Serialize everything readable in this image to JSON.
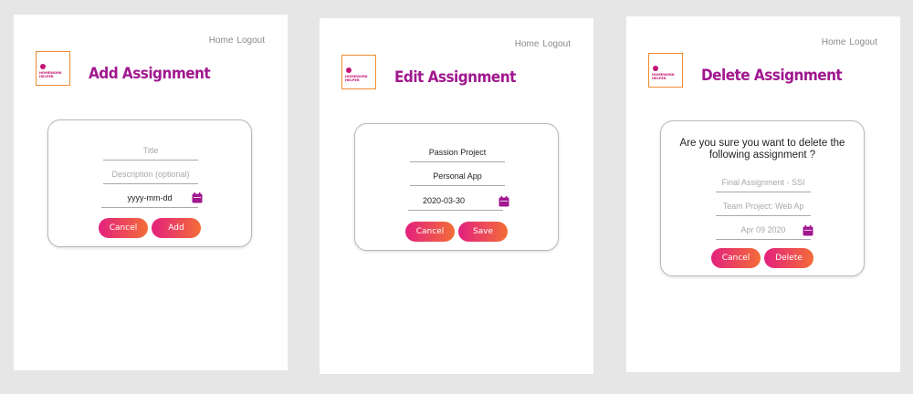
{
  "screens": {
    "add": {
      "nav": {
        "home": "Home",
        "logout": "Logout"
      },
      "logo_text": "HOMEWORK\nHELPER",
      "title": "Add Assignment",
      "fields": {
        "title_placeholder": "Title",
        "description_placeholder": "Description (optional)",
        "date_placeholder": "yyyy-mm-dd"
      },
      "buttons": {
        "cancel": "Cancel",
        "submit": "Add"
      }
    },
    "edit": {
      "nav": {
        "home": "Home",
        "logout": "Logout"
      },
      "logo_text": "HOMEWORK\nHELPER",
      "title": "Edit Assignment",
      "fields": {
        "title_value": "Passion Project",
        "description_value": "Personal App",
        "date_value": "2020-03-30"
      },
      "buttons": {
        "cancel": "Cancel",
        "submit": "Save"
      }
    },
    "delete": {
      "nav": {
        "home": "Home",
        "logout": "Logout"
      },
      "logo_text": "HOMEWORK\nHELPER",
      "title": "Delete Assignment",
      "question": "Are you sure you want to delete the following assignment ?",
      "fields": {
        "title_value": "Final Assignment - SSI",
        "description_value": "Team Project: Web Ap",
        "date_value": "Apr 09 2020"
      },
      "buttons": {
        "cancel": "Cancel",
        "submit": "Delete"
      }
    }
  },
  "colors": {
    "accent": "#a0188f",
    "gradient_start": "#e3217d",
    "gradient_end": "#f36d38",
    "logo_border": "#f08a30",
    "calendar_icon": "#a0188f"
  }
}
